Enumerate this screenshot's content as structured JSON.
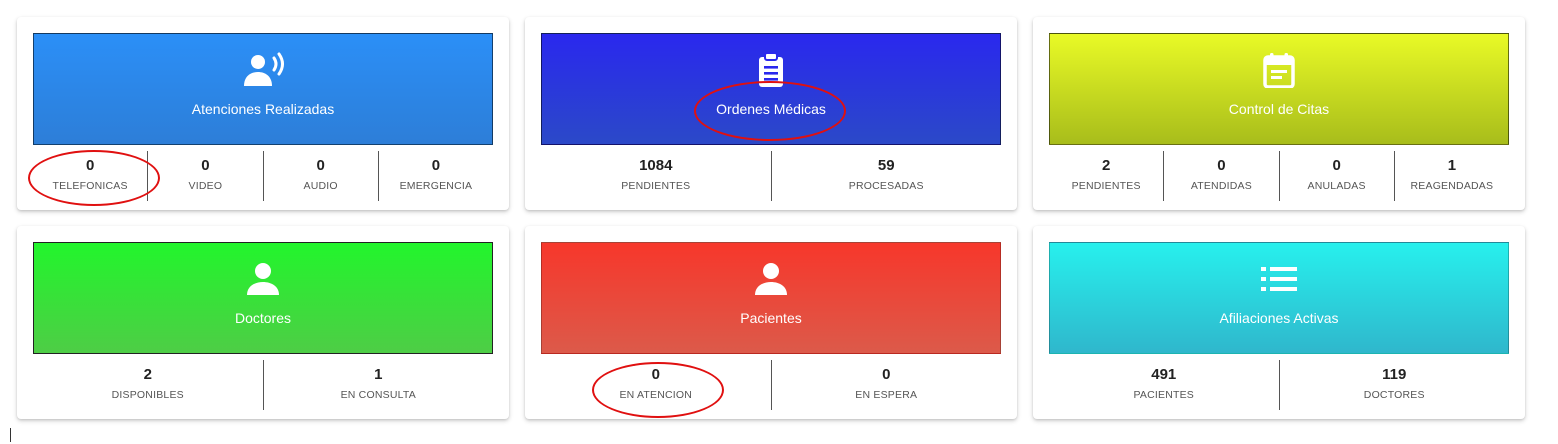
{
  "cards": [
    {
      "title": "Atenciones Realizadas",
      "icon": "speaking-person-icon",
      "color": "#2b8ff7",
      "stats": [
        {
          "value": "0",
          "label": "TELEFONICAS"
        },
        {
          "value": "0",
          "label": "VIDEO"
        },
        {
          "value": "0",
          "label": "AUDIO"
        },
        {
          "value": "0",
          "label": "EMERGENCIA"
        }
      ]
    },
    {
      "title": "Ordenes Médicas",
      "icon": "clipboard-icon",
      "color": "#2a28ee",
      "stats": [
        {
          "value": "1084",
          "label": "PENDIENTES"
        },
        {
          "value": "59",
          "label": "PROCESADAS"
        }
      ]
    },
    {
      "title": "Control de Citas",
      "icon": "calendar-icon",
      "color": "#e9fa26",
      "stats": [
        {
          "value": "2",
          "label": "PENDIENTES"
        },
        {
          "value": "0",
          "label": "ATENDIDAS"
        },
        {
          "value": "0",
          "label": "ANULADAS"
        },
        {
          "value": "1",
          "label": "REAGENDADAS"
        }
      ]
    },
    {
      "title": "Doctores",
      "icon": "person-icon",
      "color": "#22f52c",
      "stats": [
        {
          "value": "2",
          "label": "DISPONIBLES"
        },
        {
          "value": "1",
          "label": "EN CONSULTA"
        }
      ]
    },
    {
      "title": "Pacientes",
      "icon": "person-icon",
      "color": "#f7372b",
      "stats": [
        {
          "value": "0",
          "label": "EN ATENCION"
        },
        {
          "value": "0",
          "label": "EN ESPERA"
        }
      ]
    },
    {
      "title": "Afiliaciones Activas",
      "icon": "list-icon",
      "color": "#27f0ed",
      "stats": [
        {
          "value": "491",
          "label": "PACIENTES"
        },
        {
          "value": "119",
          "label": "DOCTORES"
        }
      ]
    }
  ],
  "annotation_color": "#e01010"
}
